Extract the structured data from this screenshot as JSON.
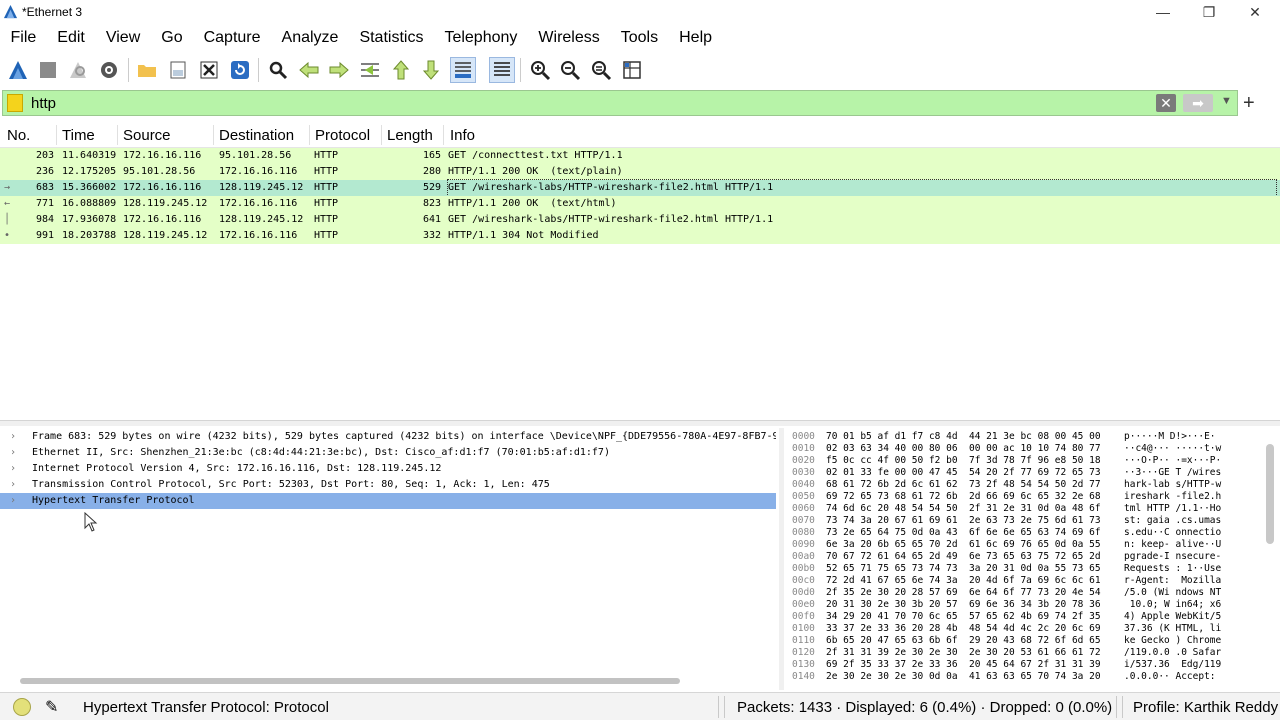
{
  "window": {
    "title": "*Ethernet 3",
    "minimize": "—",
    "maximize": "❐",
    "close": "✕"
  },
  "menu": [
    "File",
    "Edit",
    "View",
    "Go",
    "Capture",
    "Analyze",
    "Statistics",
    "Telephony",
    "Wireless",
    "Tools",
    "Help"
  ],
  "toolbar_icons": [
    "shark-fin-start-icon",
    "stop-icon",
    "restart-icon",
    "capture-options-icon",
    "open-folder-icon",
    "save-file-icon",
    "close-file-icon",
    "reload-icon",
    "find-icon",
    "go-back-icon",
    "go-forward-icon",
    "go-to-packet-icon",
    "first-packet-icon",
    "last-packet-icon",
    "autoscroll-icon",
    "colorize-icon",
    "zoom-in-icon",
    "zoom-out-icon",
    "zoom-reset-icon",
    "resize-columns-icon"
  ],
  "filter": {
    "value": "http",
    "clear": "✕",
    "apply": "➡",
    "dropdown": "▼",
    "add": "+"
  },
  "packet_columns": {
    "no": "No.",
    "time": "Time",
    "source": "Source",
    "destination": "Destination",
    "protocol": "Protocol",
    "length": "Length",
    "info": "Info"
  },
  "packets": [
    {
      "no": "203",
      "time": "11.640319",
      "source": "172.16.16.116",
      "destination": "95.101.28.56",
      "protocol": "HTTP",
      "length": "165",
      "info": "GET /connecttest.txt HTTP/1.1",
      "marker": "",
      "selected": false
    },
    {
      "no": "236",
      "time": "12.175205",
      "source": "95.101.28.56",
      "destination": "172.16.16.116",
      "protocol": "HTTP",
      "length": "280",
      "info": "HTTP/1.1 200 OK  (text/plain)",
      "marker": "",
      "selected": false
    },
    {
      "no": "683",
      "time": "15.366002",
      "source": "172.16.16.116",
      "destination": "128.119.245.12",
      "protocol": "HTTP",
      "length": "529",
      "info": "GET /wireshark-labs/HTTP-wireshark-file2.html HTTP/1.1",
      "marker": "→",
      "selected": true
    },
    {
      "no": "771",
      "time": "16.088809",
      "source": "128.119.245.12",
      "destination": "172.16.16.116",
      "protocol": "HTTP",
      "length": "823",
      "info": "HTTP/1.1 200 OK  (text/html)",
      "marker": "←",
      "selected": false
    },
    {
      "no": "984",
      "time": "17.936078",
      "source": "172.16.16.116",
      "destination": "128.119.245.12",
      "protocol": "HTTP",
      "length": "641",
      "info": "GET /wireshark-labs/HTTP-wireshark-file2.html HTTP/1.1",
      "marker": "│",
      "selected": false
    },
    {
      "no": "991",
      "time": "18.203788",
      "source": "128.119.245.12",
      "destination": "172.16.16.116",
      "protocol": "HTTP",
      "length": "332",
      "info": "HTTP/1.1 304 Not Modified",
      "marker": "•",
      "selected": false
    }
  ],
  "details": [
    {
      "text": "Frame 683: 529 bytes on wire (4232 bits), 529 bytes captured (4232 bits) on interface \\Device\\NPF_{DDE79556-780A-4E97-8FB7-9FE1",
      "selected": false
    },
    {
      "text": "Ethernet II, Src: Shenzhen_21:3e:bc (c8:4d:44:21:3e:bc), Dst: Cisco_af:d1:f7 (70:01:b5:af:d1:f7)",
      "selected": false
    },
    {
      "text": "Internet Protocol Version 4, Src: 172.16.16.116, Dst: 128.119.245.12",
      "selected": false
    },
    {
      "text": "Transmission Control Protocol, Src Port: 52303, Dst Port: 80, Seq: 1, Ack: 1, Len: 475",
      "selected": false
    },
    {
      "text": "Hypertext Transfer Protocol",
      "selected": true
    }
  ],
  "detail_expander": "›",
  "hex": [
    {
      "offset": "0000",
      "bytes": "70 01 b5 af d1 f7 c8 4d  44 21 3e bc 08 00 45 00",
      "ascii": "p·····M D!>···E·"
    },
    {
      "offset": "0010",
      "bytes": "02 03 63 34 40 00 80 06  00 00 ac 10 10 74 80 77",
      "ascii": "··c4@··· ·····t·w"
    },
    {
      "offset": "0020",
      "bytes": "f5 0c cc 4f 00 50 f2 b0  7f 3d 78 7f 96 e8 50 18",
      "ascii": "···O·P·· ·=x···P·"
    },
    {
      "offset": "0030",
      "bytes": "02 01 33 fe 00 00 47 45  54 20 2f 77 69 72 65 73",
      "ascii": "··3···GE T /wires"
    },
    {
      "offset": "0040",
      "bytes": "68 61 72 6b 2d 6c 61 62  73 2f 48 54 54 50 2d 77",
      "ascii": "hark-lab s/HTTP-w"
    },
    {
      "offset": "0050",
      "bytes": "69 72 65 73 68 61 72 6b  2d 66 69 6c 65 32 2e 68",
      "ascii": "ireshark -file2.h"
    },
    {
      "offset": "0060",
      "bytes": "74 6d 6c 20 48 54 54 50  2f 31 2e 31 0d 0a 48 6f",
      "ascii": "tml HTTP /1.1··Ho"
    },
    {
      "offset": "0070",
      "bytes": "73 74 3a 20 67 61 69 61  2e 63 73 2e 75 6d 61 73",
      "ascii": "st: gaia .cs.umas"
    },
    {
      "offset": "0080",
      "bytes": "73 2e 65 64 75 0d 0a 43  6f 6e 6e 65 63 74 69 6f",
      "ascii": "s.edu··C onnectio"
    },
    {
      "offset": "0090",
      "bytes": "6e 3a 20 6b 65 65 70 2d  61 6c 69 76 65 0d 0a 55",
      "ascii": "n: keep- alive··U"
    },
    {
      "offset": "00a0",
      "bytes": "70 67 72 61 64 65 2d 49  6e 73 65 63 75 72 65 2d",
      "ascii": "pgrade-I nsecure-"
    },
    {
      "offset": "00b0",
      "bytes": "52 65 71 75 65 73 74 73  3a 20 31 0d 0a 55 73 65",
      "ascii": "Requests : 1··Use"
    },
    {
      "offset": "00c0",
      "bytes": "72 2d 41 67 65 6e 74 3a  20 4d 6f 7a 69 6c 6c 61",
      "ascii": "r-Agent:  Mozilla"
    },
    {
      "offset": "00d0",
      "bytes": "2f 35 2e 30 20 28 57 69  6e 64 6f 77 73 20 4e 54",
      "ascii": "/5.0 (Wi ndows NT"
    },
    {
      "offset": "00e0",
      "bytes": "20 31 30 2e 30 3b 20 57  69 6e 36 34 3b 20 78 36",
      "ascii": " 10.0; W in64; x6"
    },
    {
      "offset": "00f0",
      "bytes": "34 29 20 41 70 70 6c 65  57 65 62 4b 69 74 2f 35",
      "ascii": "4) Apple WebKit/5"
    },
    {
      "offset": "0100",
      "bytes": "33 37 2e 33 36 20 28 4b  48 54 4d 4c 2c 20 6c 69",
      "ascii": "37.36 (K HTML, li"
    },
    {
      "offset": "0110",
      "bytes": "6b 65 20 47 65 63 6b 6f  29 20 43 68 72 6f 6d 65",
      "ascii": "ke Gecko ) Chrome"
    },
    {
      "offset": "0120",
      "bytes": "2f 31 31 39 2e 30 2e 30  2e 30 20 53 61 66 61 72",
      "ascii": "/119.0.0 .0 Safar"
    },
    {
      "offset": "0130",
      "bytes": "69 2f 35 33 37 2e 33 36  20 45 64 67 2f 31 31 39",
      "ascii": "i/537.36  Edg/119"
    },
    {
      "offset": "0140",
      "bytes": "2e 30 2e 30 2e 30 0d 0a  41 63 63 65 70 74 3a 20",
      "ascii": ".0.0.0·· Accept: "
    }
  ],
  "status": {
    "edit_icon": "✎",
    "text": "Hypertext Transfer Protocol: Protocol",
    "packets": "Packets: 1433 · Displayed: 6 (0.4%) · Dropped: 0 (0.0%)",
    "profile": "Profile: Karthik Reddy"
  },
  "colors": {
    "row_bg": "#e4ffc7",
    "row_selected": "#b3e9d0",
    "detail_selected": "#88b0e8",
    "filter_valid": "#b7f3a8"
  }
}
